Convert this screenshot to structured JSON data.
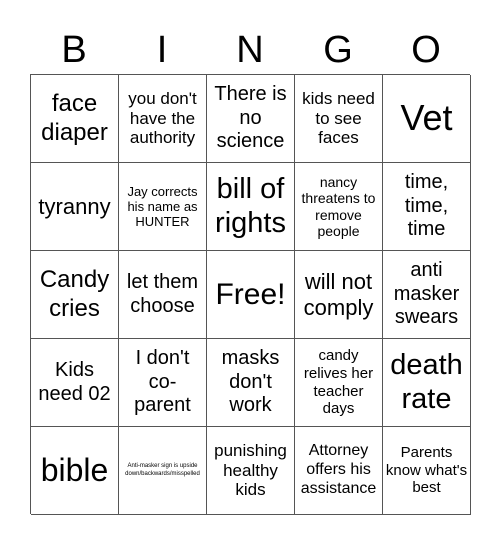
{
  "header": [
    "B",
    "I",
    "N",
    "G",
    "O"
  ],
  "cells": [
    "face diaper",
    "you don't have the authority",
    "There is no science",
    "kids need to see faces",
    "Vet",
    "tyranny",
    "Jay corrects his name as HUNTER",
    "bill of rights",
    "nancy threatens to remove people",
    "time, time, time",
    "Candy cries",
    "let them choose",
    "Free!",
    "will not comply",
    "anti masker swears",
    "Kids need 02",
    "I don't co-parent",
    "masks don't work",
    "candy relives her teacher days",
    "death rate",
    "bible",
    "Anti-masker sign is upside down/backwards/misspelled",
    "punishing healthy kids",
    "Attorney offers his assistance",
    "Parents know what's best"
  ]
}
